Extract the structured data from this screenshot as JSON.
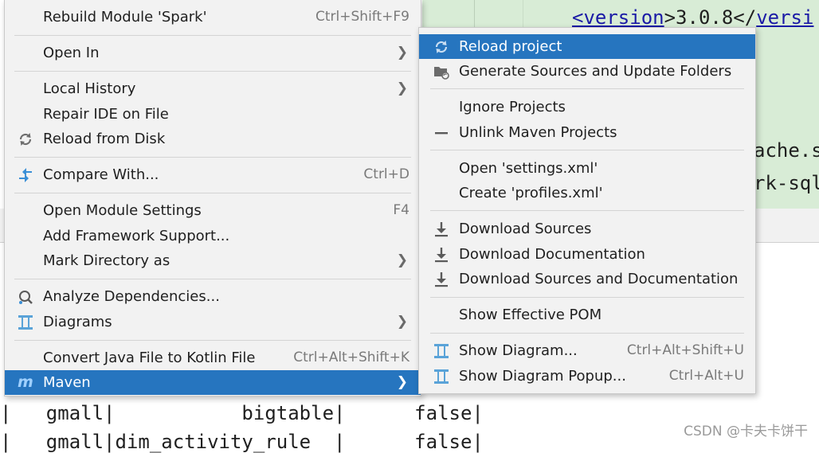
{
  "editor": {
    "line1_prefix": "<",
    "line1_tag": "version",
    "line1_mid": ">3.0.8</",
    "line1_tag2": "versi",
    "line2": "ache.s",
    "line3": "rk-sql"
  },
  "console": {
    "row1": "|   gmall|           bigtable|      false|",
    "row2": "|   gmall|dim_activity_rule  |      false|"
  },
  "watermark": "CSDN @卡夫卡饼干",
  "main_menu": {
    "rebuild_module": "Rebuild Module 'Spark'",
    "rebuild_shortcut": "Ctrl+Shift+F9",
    "open_in": "Open In",
    "local_history": "Local History",
    "repair_ide": "Repair IDE on File",
    "reload_from_disk": "Reload from Disk",
    "compare_with": "Compare With...",
    "compare_shortcut": "Ctrl+D",
    "open_module_settings": "Open Module Settings",
    "open_module_shortcut": "F4",
    "add_framework": "Add Framework Support...",
    "mark_directory": "Mark Directory as",
    "analyze_deps": "Analyze Dependencies...",
    "diagrams": "Diagrams",
    "convert_kotlin": "Convert Java File to Kotlin File",
    "convert_shortcut": "Ctrl+Alt+Shift+K",
    "maven": "Maven"
  },
  "maven_submenu": {
    "reload_project": "Reload project",
    "generate_sources": "Generate Sources and Update Folders",
    "ignore_projects": "Ignore Projects",
    "unlink_projects": "Unlink Maven Projects",
    "open_settings": "Open 'settings.xml'",
    "create_profiles": "Create 'profiles.xml'",
    "download_sources": "Download Sources",
    "download_docs": "Download Documentation",
    "download_both": "Download Sources and Documentation",
    "show_pom": "Show Effective POM",
    "show_diagram": "Show Diagram...",
    "show_diagram_shortcut": "Ctrl+Alt+Shift+U",
    "show_diagram_popup": "Show Diagram Popup...",
    "show_popup_shortcut": "Ctrl+Alt+U"
  },
  "icons": [
    "refresh-icon",
    "compare-icon",
    "analyze-icon",
    "diagram-icon",
    "maven-icon",
    "folder-refresh-icon",
    "minus-icon",
    "download-icon",
    "chevron-right-icon"
  ],
  "colors": {
    "selection": "#2675bf",
    "menu_bg": "#f2f2f2",
    "editor_bg": "#d8ecd6"
  }
}
